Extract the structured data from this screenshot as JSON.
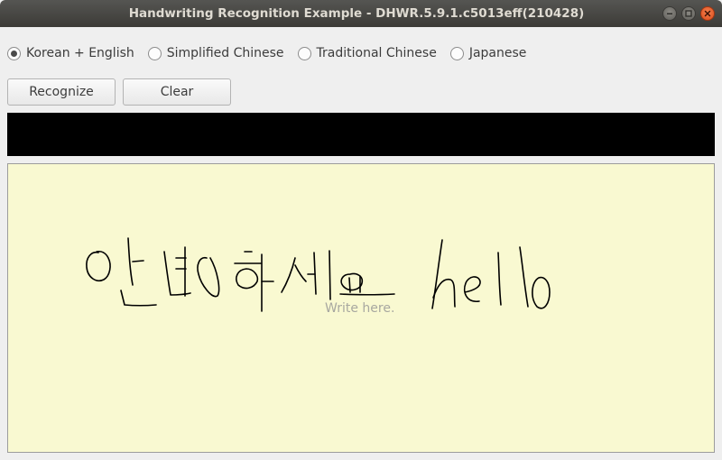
{
  "window": {
    "title": "Handwriting Recognition Example - DHWR.5.9.1.c5013eff(210428)"
  },
  "languages": {
    "options": [
      {
        "label": "Korean + English",
        "selected": true
      },
      {
        "label": "Simplified Chinese",
        "selected": false
      },
      {
        "label": "Traditional Chinese",
        "selected": false
      },
      {
        "label": "Japanese",
        "selected": false
      }
    ]
  },
  "toolbar": {
    "recognize_label": "Recognize",
    "clear_label": "Clear"
  },
  "result": {
    "text": ""
  },
  "canvas": {
    "placeholder": "Write here.",
    "background_color": "#f9f9d1",
    "ink_color": "#000000",
    "handwritten_content": "안녕하세요 hello"
  },
  "icons": {
    "minimize": "minimize-icon",
    "maximize": "maximize-icon",
    "close": "close-icon"
  }
}
